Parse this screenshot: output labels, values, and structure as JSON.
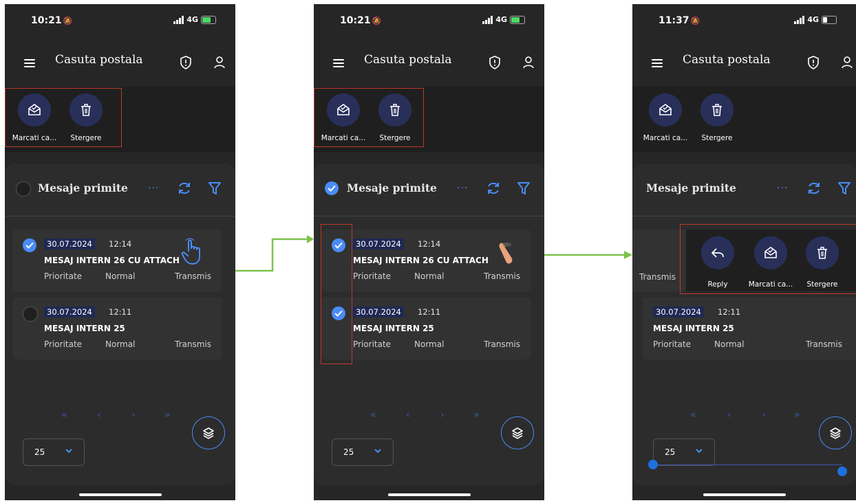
{
  "colors": {
    "accent": "#4a8cf5",
    "bg": "#262626",
    "circle": "#28305a",
    "highlight": "#c0392b",
    "arrow": "#7dc24b"
  },
  "phones": [
    {
      "time": "10:21",
      "network": "4G",
      "title": "Casuta postala",
      "toolbar": [
        "Marcati ca...",
        "Stergere"
      ],
      "list_header": "Mesaje primite",
      "messages": [
        {
          "date": "30.07.2024",
          "time": "12:14",
          "subject": "MESAJ INTERN 26 CU ATTACH",
          "priority_label": "Prioritate",
          "priority": "Normal",
          "status": "Transmis"
        },
        {
          "date": "30.07.2024",
          "time": "12:11",
          "subject": "MESAJ INTERN 25",
          "priority_label": "Prioritate",
          "priority": "Normal",
          "status": "Transmis"
        }
      ],
      "pagination": [
        "«",
        "‹",
        "›",
        "»"
      ],
      "page_size": "25"
    },
    {
      "time": "10:21",
      "network": "4G",
      "title": "Casuta postala",
      "toolbar": [
        "Marcati ca...",
        "Stergere"
      ],
      "list_header": "Mesaje primite",
      "messages": [
        {
          "date": "30.07.2024",
          "time": "12:14",
          "subject": "MESAJ INTERN 26 CU ATTACH",
          "priority_label": "Prioritate",
          "priority": "Normal",
          "status": "Transmis"
        },
        {
          "date": "30.07.2024",
          "time": "12:11",
          "subject": "MESAJ INTERN 25",
          "priority_label": "Prioritate",
          "priority": "Normal",
          "status": "Transmis"
        }
      ],
      "pagination": [
        "«",
        "‹",
        "›",
        "»"
      ],
      "page_size": "25"
    },
    {
      "time": "11:37",
      "network": "4G",
      "title": "Casuta postala",
      "toolbar": [
        "Marcati ca...",
        "Stergere"
      ],
      "list_header": "Mesaje primite",
      "swipe_status": "Transmis",
      "swipe_actions": [
        "Reply",
        "Marcati ca...",
        "Stergere"
      ],
      "messages": [
        {
          "date": "30.07.2024",
          "time": "12:11",
          "subject": "MESAJ INTERN 25",
          "priority_label": "Prioritate",
          "priority": "Normal",
          "status": "Transmis"
        }
      ],
      "pagination": [
        "«",
        "‹",
        "›",
        "»"
      ],
      "page_size": "25"
    }
  ]
}
